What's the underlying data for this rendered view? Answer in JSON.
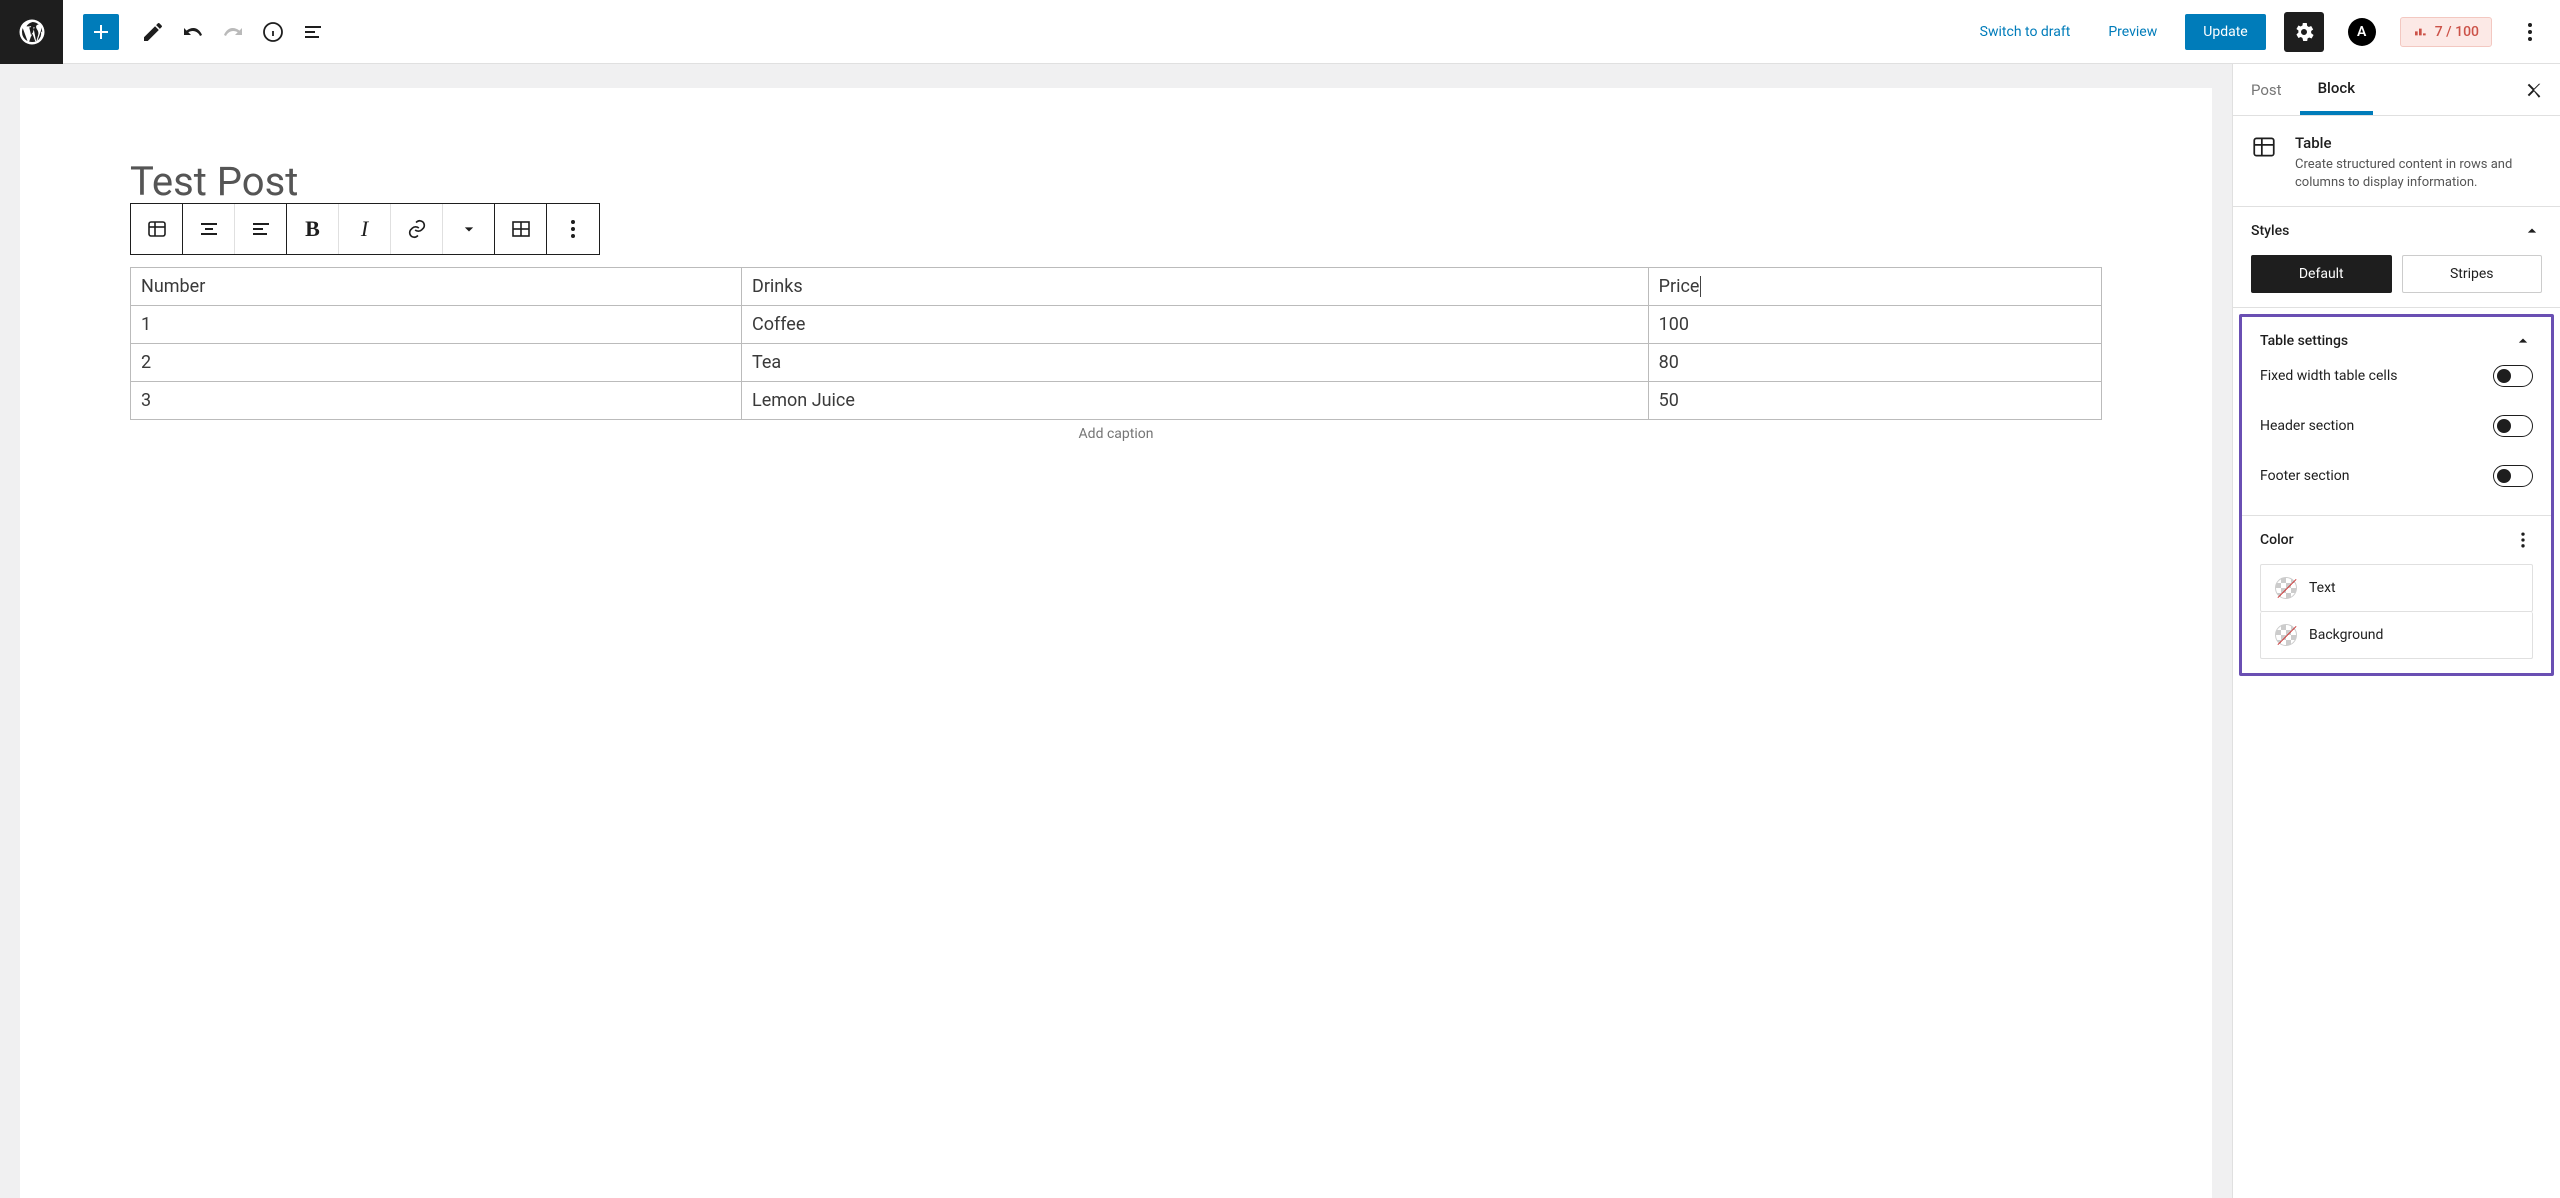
{
  "topbar": {
    "switch_draft": "Switch to draft",
    "preview": "Preview",
    "update": "Update",
    "rank_value": "7",
    "rank_sep": " / ",
    "rank_max": "100"
  },
  "post": {
    "title": "Test Post",
    "caption_placeholder": "Add caption"
  },
  "table": {
    "headers": [
      "Number",
      "Drinks",
      "Price"
    ],
    "rows": [
      [
        "1",
        "Coffee",
        "100"
      ],
      [
        "2",
        "Tea",
        "80"
      ],
      [
        "3",
        "Lemon Juice",
        "50"
      ]
    ]
  },
  "sidebar": {
    "tabs": {
      "post": "Post",
      "block": "Block"
    },
    "block_info": {
      "title": "Table",
      "desc": "Create structured content in rows and columns to display information."
    },
    "styles": {
      "label": "Styles",
      "default": "Default",
      "stripes": "Stripes"
    },
    "table_settings": {
      "label": "Table settings",
      "fixed_width": "Fixed width table cells",
      "header_section": "Header section",
      "footer_section": "Footer section"
    },
    "color": {
      "label": "Color",
      "text": "Text",
      "background": "Background"
    }
  }
}
